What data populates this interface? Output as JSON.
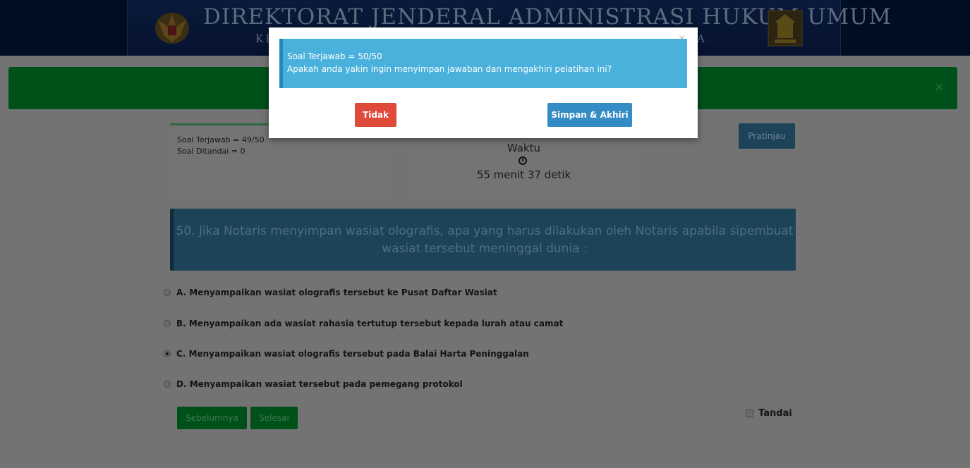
{
  "header": {
    "title": "DIREKTORAT JENDERAL ADMINISTRASI HUKUM UMUM",
    "subtitle_left": "KE",
    "subtitle_right": "A"
  },
  "status": {
    "answered": "Soal Terjawab = 49/50",
    "marked": "Soal Ditandai = 0"
  },
  "timer": {
    "label": "Waktu",
    "remaining": "55 menit 37 detik"
  },
  "preview_button": "Pratinjau",
  "question": {
    "text": "50. Jika Notaris menyimpan wasiat olografis, apa yang harus dilakukan oleh Notaris apabila sipembuat wasiat tersebut meninggal dunia :"
  },
  "options": [
    {
      "label": "A. Menyampaikan wasiat olografis tersebut ke Pusat Daftar Wasiat",
      "selected": false
    },
    {
      "label": "B. Menyampaikan ada wasiat rahasia tertutup tersebut kepada lurah atau camat",
      "selected": false
    },
    {
      "label": "C. Menyampaikan wasiat olografis tersebut pada Balai Harta Peninggalan",
      "selected": true
    },
    {
      "label": "D. Menyampaikan wasiat tersebut pada pemegang protokol",
      "selected": false
    }
  ],
  "nav": {
    "prev": "Sebelumnya",
    "finish": "Selesai",
    "mark": "Tandai"
  },
  "modal": {
    "close": "×",
    "line1": "Soal Terjawab = 50/50",
    "line2": "Apakah anda yakin ingin menyimpan jawaban dan mengakhiri pelatihan ini?",
    "cancel": "Tidak",
    "confirm": "Simpan & Akhiri"
  },
  "green_alert_close": "×",
  "colors": {
    "modal_alert": "#4ab1dc",
    "cancel": "#e04a3a",
    "confirm": "#348cc4",
    "success": "#00501a"
  }
}
